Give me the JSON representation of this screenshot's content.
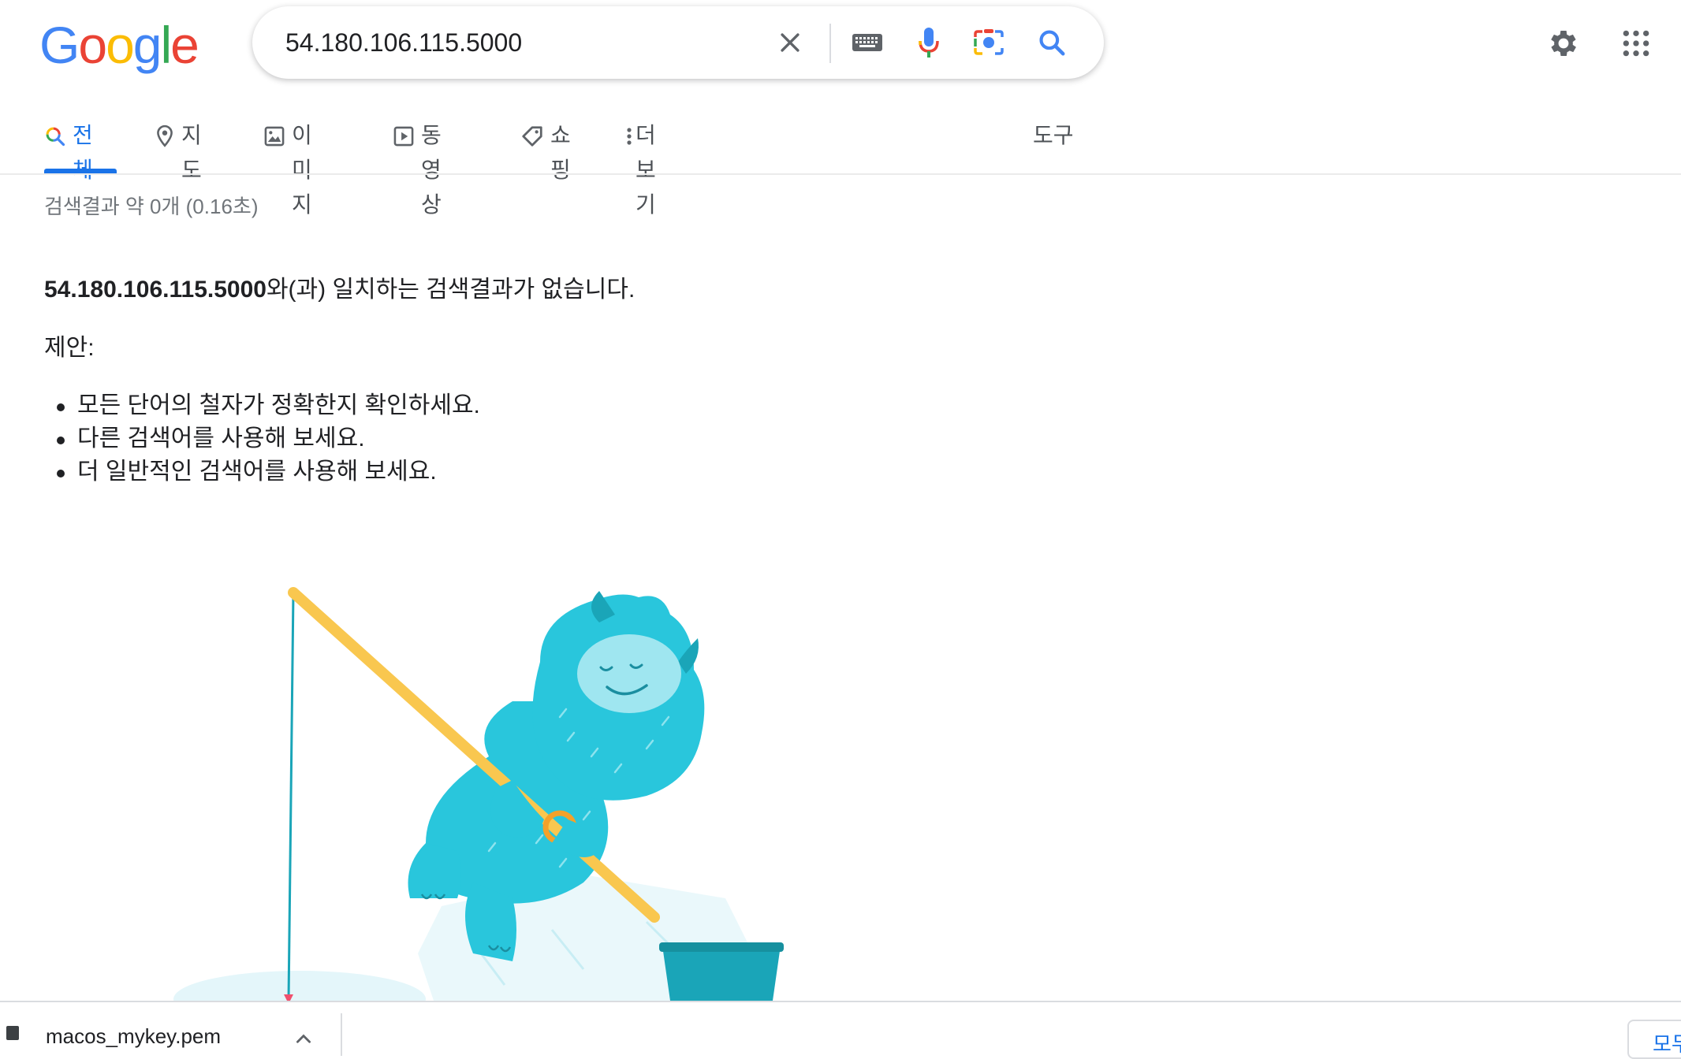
{
  "logo": {
    "letters": [
      "G",
      "o",
      "o",
      "g",
      "l",
      "e"
    ]
  },
  "search": {
    "query": "54.180.106.115.5000"
  },
  "icons": {
    "clear": "close-icon",
    "keyboard": "keyboard-icon",
    "voice": "microphone-icon",
    "lens": "camera-lens-icon",
    "search": "search-icon",
    "settings": "gear-icon",
    "apps": "apps-grid-icon"
  },
  "tabs": [
    {
      "label": "전체",
      "icon": "search-icon",
      "active": true
    },
    {
      "label": "지도",
      "icon": "map-pin-icon"
    },
    {
      "label": "이미지",
      "icon": "image-icon"
    },
    {
      "label": "동영상",
      "icon": "play-icon"
    },
    {
      "label": "쇼핑",
      "icon": "tag-icon"
    },
    {
      "label": "더보기",
      "icon": "more-vert-icon"
    }
  ],
  "tools_label": "도구",
  "result_stats": "검색결과 약 0개 (0.16초)",
  "no_results": {
    "query": "54.180.106.115.5000",
    "message": "와(과) 일치하는 검색결과가 없습니다."
  },
  "suggestions": {
    "heading": "제안:",
    "items": [
      "모든 단어의 철자가 정확한지 확인하세요.",
      "다른 검색어를 사용해 보세요.",
      "더 일반적인 검색어를 사용해 보세요."
    ]
  },
  "download_bar": {
    "file_name": "macos_mykey.pem",
    "show_all": "모두"
  },
  "colors": {
    "accent": "#1a73e8",
    "text": "#202124",
    "muted": "#70757a",
    "yeti": "#29c6dc"
  }
}
